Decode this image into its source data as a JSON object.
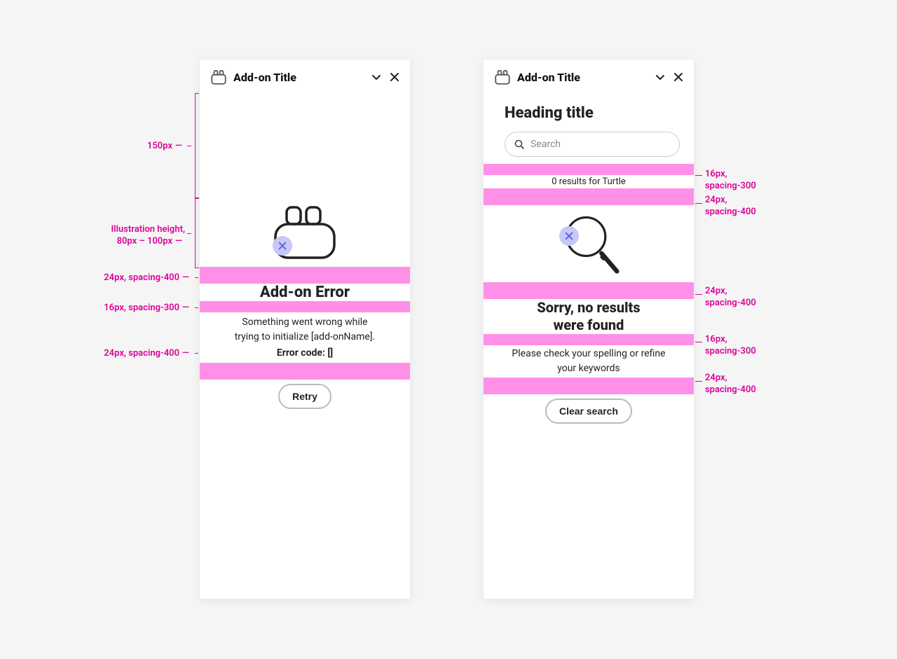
{
  "left_panel": {
    "title": "Add-on Title",
    "error_heading": "Add-on Error",
    "error_body_1": "Something went wrong while",
    "error_body_2": "trying to initialize [add-onName].",
    "error_code_label": "Error code: []",
    "retry_label": "Retry"
  },
  "right_panel": {
    "title": "Add-on Title",
    "page_heading": "Heading title",
    "search_placeholder": "Search",
    "results_line": "0 results for Turtle",
    "noresults_heading_1": "Sorry, no results",
    "noresults_heading_2": "were found",
    "noresults_body_1": "Please check your spelling or refine",
    "noresults_body_2": "your keywords",
    "clear_label": "Clear search"
  },
  "annotations": {
    "left": {
      "a1": "150px",
      "a2_line1": "Illustration height,",
      "a2_line2": "80px – 100px",
      "a3": "24px, spacing-400",
      "a4": "16px, spacing-300",
      "a5": "24px, spacing-400"
    },
    "right": {
      "r1_line1": "16px,",
      "r1_line2": "spacing-300",
      "r2_line1": "24px,",
      "r2_line2": "spacing-400",
      "r3_line1": "24px,",
      "r3_line2": "spacing-400",
      "r4_line1": "16px,",
      "r4_line2": "spacing-300",
      "r5_line1": "24px,",
      "r5_line2": "spacing-400"
    }
  }
}
